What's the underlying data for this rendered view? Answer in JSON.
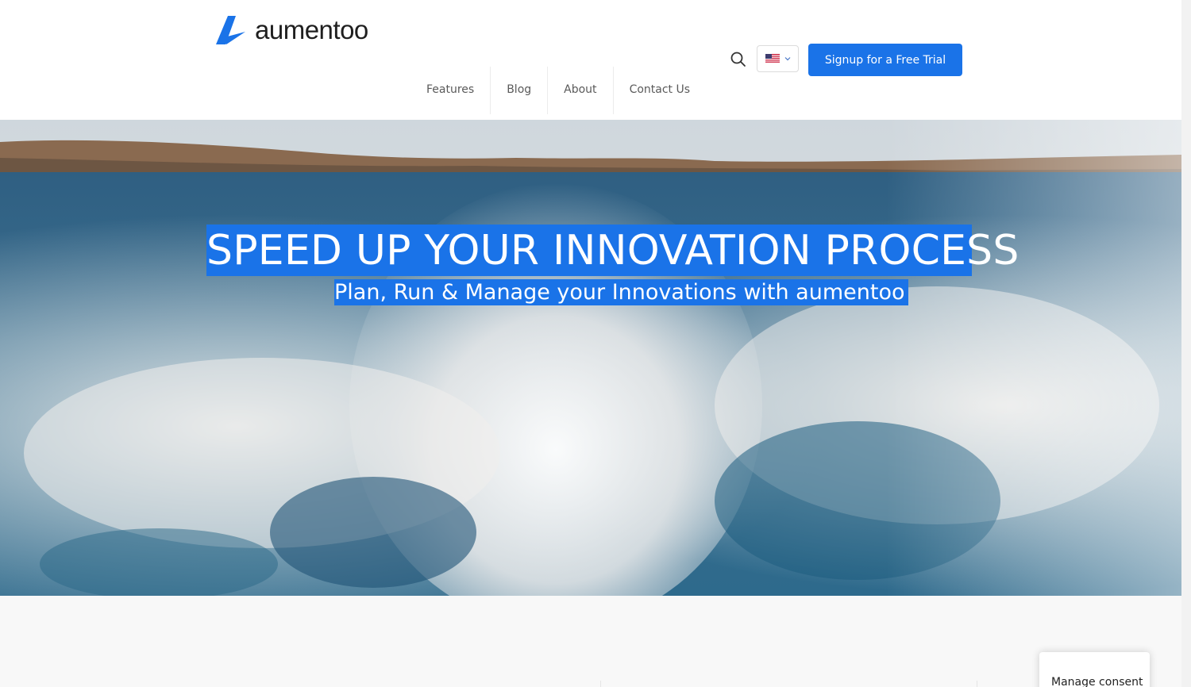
{
  "header": {
    "logo_text": "aumentoo",
    "logo_icon": "aumentoo-logo-icon",
    "search_icon": "search-icon",
    "language": {
      "flag_icon": "us-flag-icon",
      "chevron_icon": "chevron-down-icon"
    },
    "signup_label": "Signup for a Free Trial",
    "nav": [
      {
        "label": "Features"
      },
      {
        "label": "Blog"
      },
      {
        "label": "About"
      },
      {
        "label": "Contact Us"
      }
    ]
  },
  "hero": {
    "title": "SPEED UP YOUR INNOVATION PROCESS",
    "subtitle": "Plan, Run & Manage your Innovations with aumentoo"
  },
  "consent": {
    "label": "Manage consent"
  },
  "colors": {
    "accent": "#1a73e8",
    "text_dark": "#1f1f1f",
    "nav_text": "#5a5a5a"
  }
}
